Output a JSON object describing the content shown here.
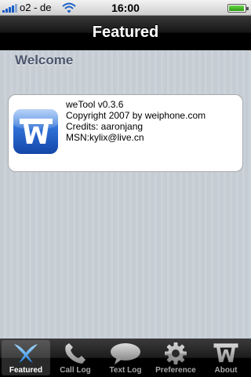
{
  "status_bar": {
    "carrier": "o2 - de",
    "time": "16:00"
  },
  "nav": {
    "title": "Featured"
  },
  "section": {
    "header": "Welcome"
  },
  "about_card": {
    "line1": "weTool v0.3.6",
    "line2": "Copyright 2007 by weiphone.com",
    "line3": "Credits: aaronjang",
    "line4": "MSN:kylix@live.cn",
    "icon": "wetool-logo-icon"
  },
  "tabs": [
    {
      "label": "Featured",
      "icon": "featured-icon",
      "selected": true
    },
    {
      "label": "Call Log",
      "icon": "phone-icon",
      "selected": false
    },
    {
      "label": "Text Log",
      "icon": "speech-bubble-icon",
      "selected": false
    },
    {
      "label": "Preference",
      "icon": "gear-icon",
      "selected": false
    },
    {
      "label": "About",
      "icon": "wetool-logo-icon",
      "selected": false
    }
  ],
  "colors": {
    "background": "#c5ccd4",
    "section_header": "#4c566c",
    "bar_dark": "#000000",
    "app_icon_blue": "#2f6fd6"
  }
}
